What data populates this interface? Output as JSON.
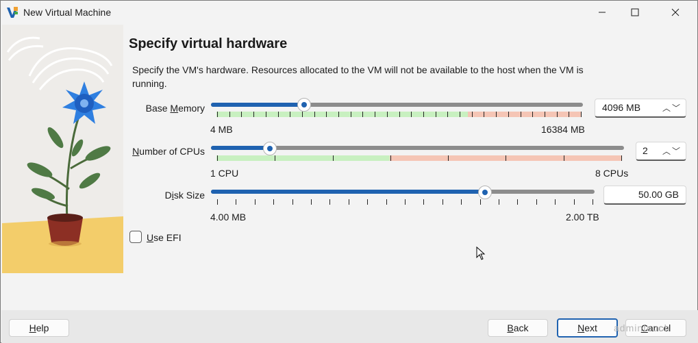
{
  "window": {
    "title": "New Virtual Machine"
  },
  "page": {
    "heading": "Specify virtual hardware",
    "description": "Specify the VM's hardware. Resources allocated to the VM will not be available to the host when the VM is running."
  },
  "memory": {
    "label_pre": "Base ",
    "label_u": "M",
    "label_post": "emory",
    "value": "4096 MB",
    "min_label": "4 MB",
    "max_label": "16384 MB",
    "fraction": 0.25
  },
  "cpus": {
    "label_u": "N",
    "label_post": "umber of CPUs",
    "value": "2",
    "min_label": "1 CPU",
    "max_label": "8 CPUs",
    "fraction": 0.143
  },
  "disk": {
    "label_pre": "D",
    "label_u": "i",
    "label_post": "sk Size",
    "value": "50.00 GB",
    "min_label": "4.00 MB",
    "max_label": "2.00 TB",
    "fraction": 0.715
  },
  "efi": {
    "label_u": "U",
    "label_post": "se EFI",
    "checked": false
  },
  "footer": {
    "help_u": "H",
    "help_post": "elp",
    "back_u": "B",
    "back_post": "ack",
    "next_u": "N",
    "next_post": "ext",
    "cancel_u": "C",
    "cancel_post": "ancel",
    "watermark": "admintouch"
  },
  "colors": {
    "accent": "#1f62b0",
    "ok_zone": "#c8f0c0",
    "warn_zone": "#f5c5b5"
  }
}
